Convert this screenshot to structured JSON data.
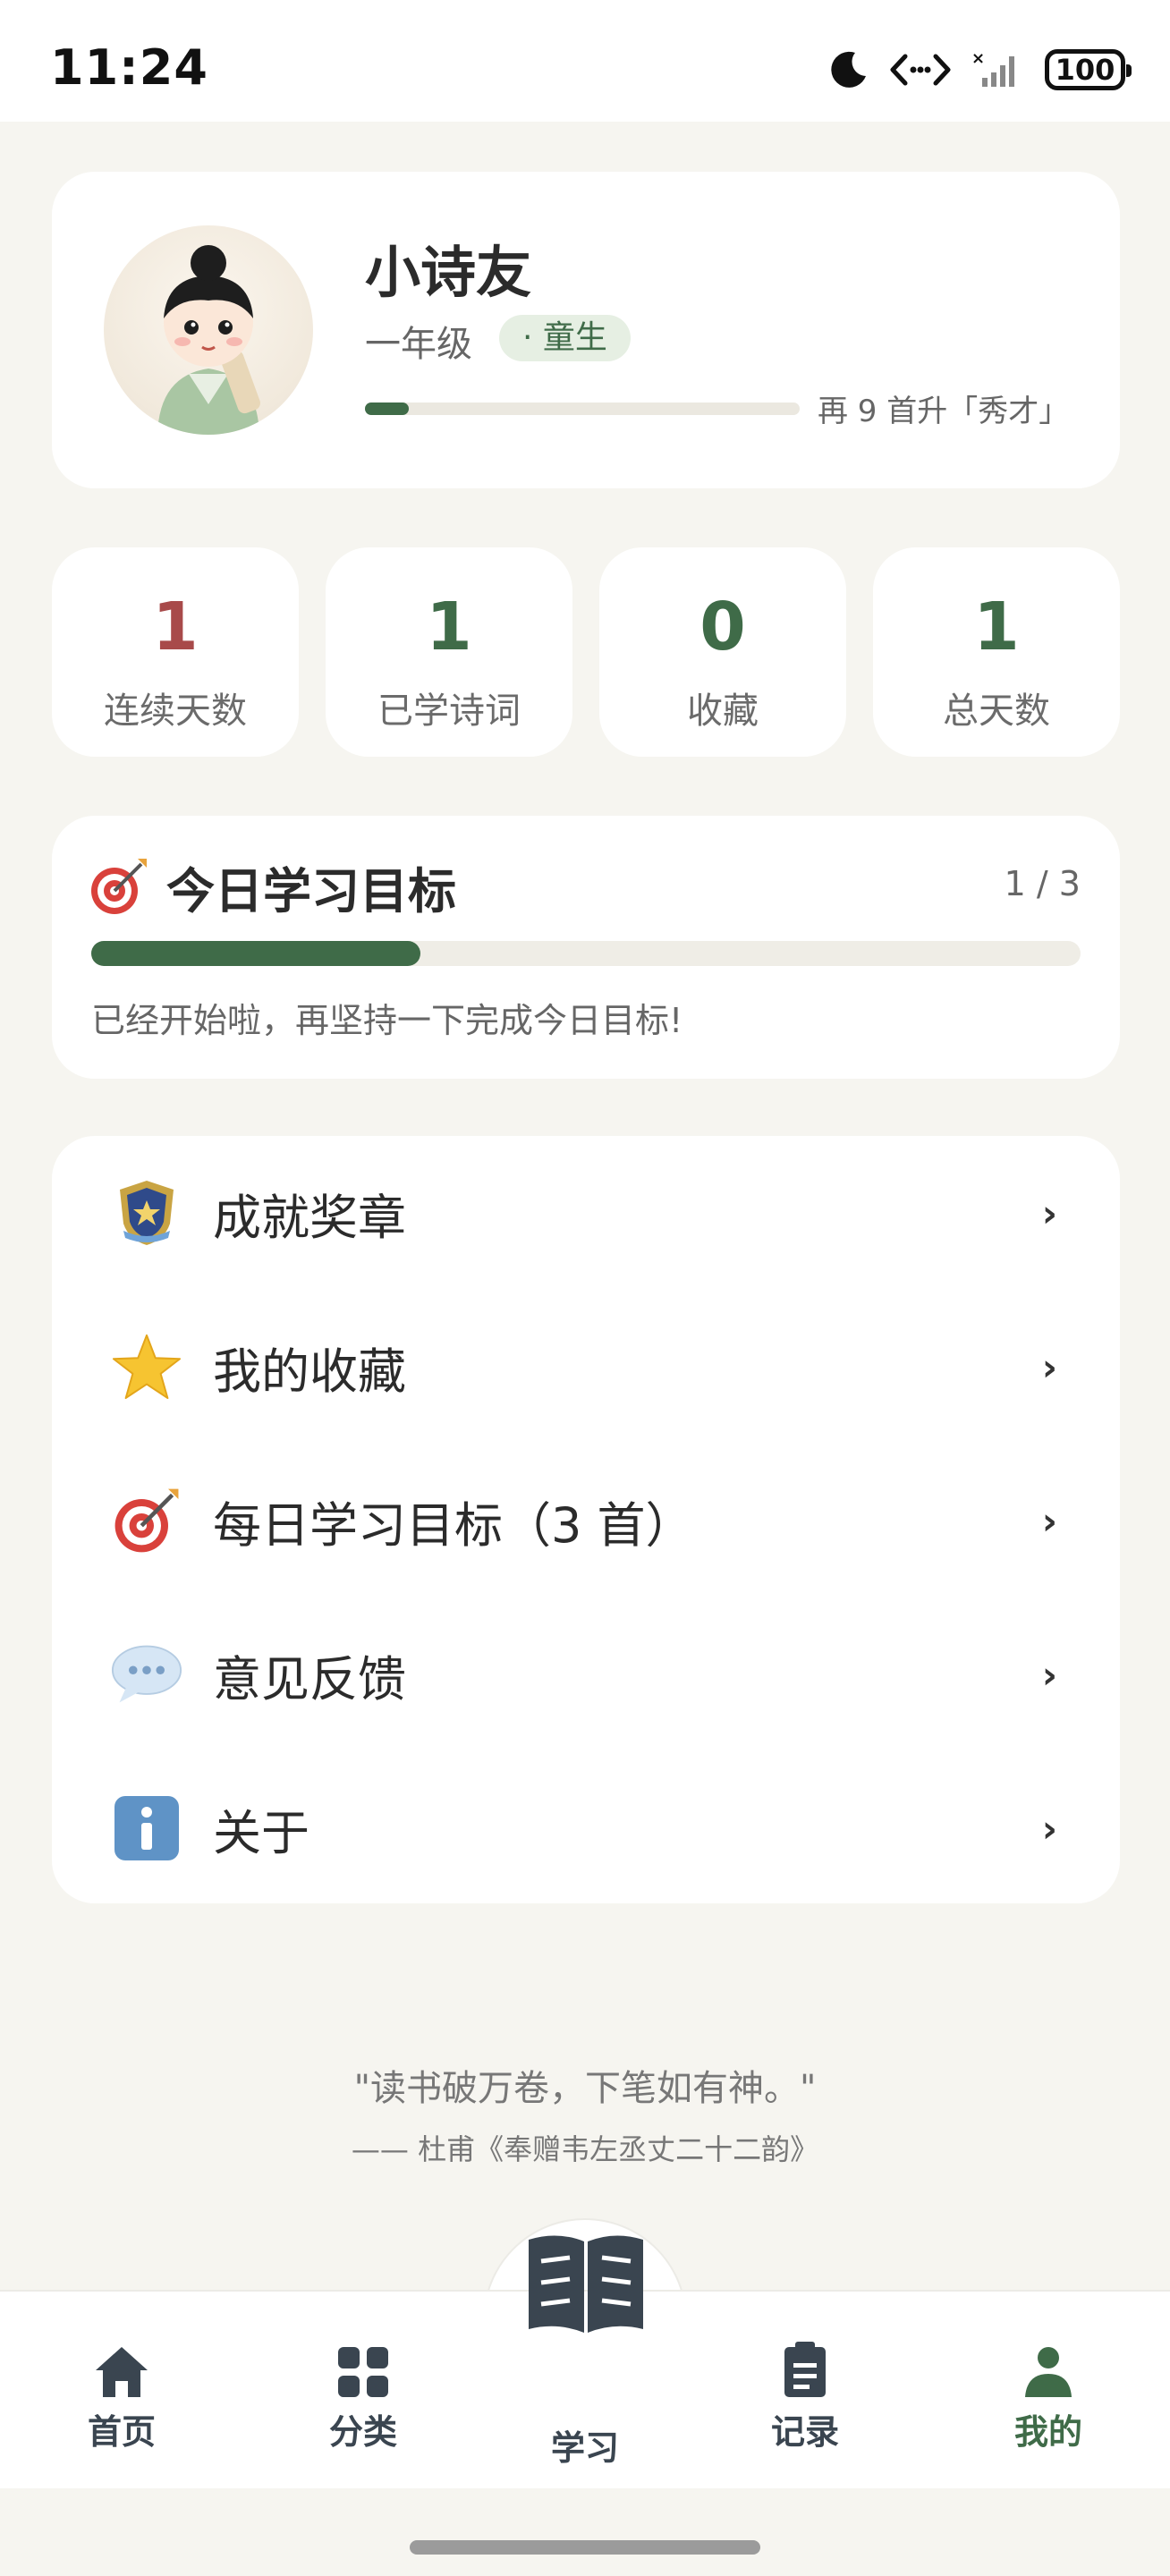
{
  "status_bar": {
    "time": "11:24",
    "battery": "100"
  },
  "profile": {
    "name": "小诗友",
    "grade": "一年级",
    "badge": "· 童生",
    "level_progress": 0.1,
    "level_text": "再 9 首升「秀才」"
  },
  "stats": [
    {
      "value": "1",
      "label": "连续天数",
      "color": "#a84a4a"
    },
    {
      "value": "1",
      "label": "已学诗词",
      "color": "#3f6b48"
    },
    {
      "value": "0",
      "label": "收藏",
      "color": "#3f6b48"
    },
    {
      "value": "1",
      "label": "总天数",
      "color": "#3f6b48"
    }
  ],
  "goal": {
    "title": "今日学习目标",
    "count": "1 / 3",
    "progress": 0.333,
    "message": "已经开始啦，再坚持一下完成今日目标!"
  },
  "menu": [
    {
      "icon": "medal-icon",
      "label": "成就奖章"
    },
    {
      "icon": "star-icon",
      "label": "我的收藏"
    },
    {
      "icon": "target-icon",
      "label": "每日学习目标（3 首）"
    },
    {
      "icon": "speech-bubble-icon",
      "label": "意见反馈"
    },
    {
      "icon": "info-icon",
      "label": "关于"
    }
  ],
  "quote": {
    "text": "\"读书破万卷，下笔如有神。\"",
    "source": "—— 杜甫《奉赠韦左丞丈二十二韵》"
  },
  "nav": {
    "home": "首页",
    "category": "分类",
    "study": "学习",
    "records": "记录",
    "mine": "我的"
  },
  "colors": {
    "accent": "#3f6b48",
    "streak": "#a84a4a",
    "background": "#f6f5f0"
  }
}
